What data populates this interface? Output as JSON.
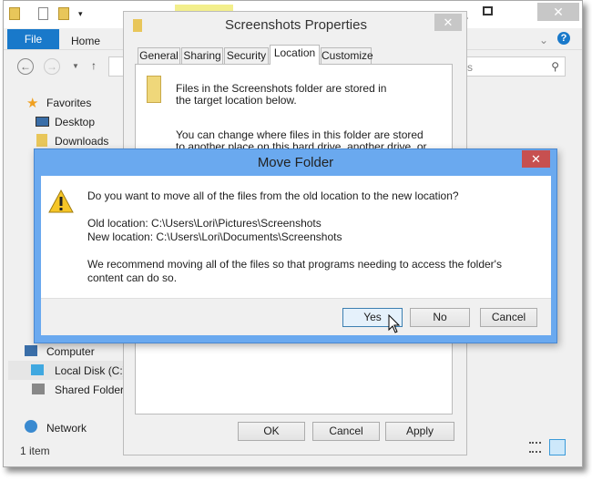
{
  "explorer": {
    "title_highlight": "#f3ef8c",
    "ribbon_tabs": [
      "File",
      "Home"
    ],
    "search_partial": "ots",
    "nav": {
      "favorites": "Favorites",
      "desktop": "Desktop",
      "downloads": "Downloads",
      "computer": "Computer",
      "local_disk": "Local Disk (C:)",
      "shared": "Shared Folders",
      "network": "Network"
    },
    "status": "1 item"
  },
  "properties": {
    "title": "Screenshots Properties",
    "tabs": [
      "General",
      "Sharing",
      "Security",
      "Location",
      "Customize"
    ],
    "active_tab": "Location",
    "text1": "Files in the Screenshots folder are stored in the target location below.",
    "text2": "You can change where files in this folder are stored to another place on this hard drive, another drive, or another",
    "buttons": {
      "ok": "OK",
      "cancel": "Cancel",
      "apply": "Apply"
    }
  },
  "move_dialog": {
    "title": "Move Folder",
    "question": "Do you want to move all of the files from the old location to the new location?",
    "old_location": "Old location: C:\\Users\\Lori\\Pictures\\Screenshots",
    "new_location": "New location: C:\\Users\\Lori\\Documents\\Screenshots",
    "recommendation": "We recommend moving all of the files so that programs needing to access the folder's content can do so.",
    "buttons": {
      "yes": "Yes",
      "no": "No",
      "cancel": "Cancel"
    },
    "accent": "#6aa9ef",
    "close_color": "#c75050"
  }
}
